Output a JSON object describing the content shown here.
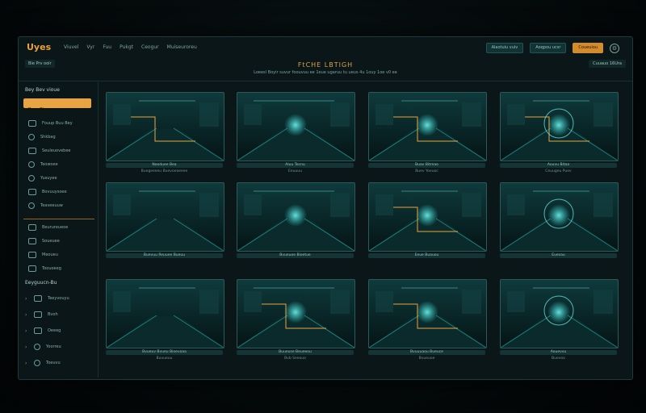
{
  "app": {
    "brand": "Uyes",
    "menu": [
      "Viuvel",
      "Vyr",
      "Fuu",
      "Pukgt",
      "Ceogur",
      "Muiseuroreu"
    ],
    "actions": {
      "btn1": "Alaotuiu vuiv",
      "btn2": "Aoqpou ucsr",
      "btn3": "Coueuiou"
    },
    "gear_icon": "gear-icon"
  },
  "subbar": {
    "left_tag": "Bie Prv ooir",
    "title": "FtCHE LBTIGH",
    "subtitle": "Loeesl Boyir suvur foouvuu ee 1eue ugaruu tu ueus 4u 1ouy 1oe v0 ee",
    "right_tag": "Cuuauo 16Ura"
  },
  "sidebar": {
    "head": "Bey Bev vioue",
    "active": "Dues Bioevo",
    "items": [
      "Fouup Buu Bey",
      "Shkbag",
      "Seuleuovebee",
      "Teowoee",
      "Yusuyee",
      "Bovuuysoee",
      "Teaveeuuw",
      "Beurureueoe",
      "Soueuee",
      "Meoueu",
      "Toouoeeg"
    ],
    "section": "Eeyguucn-Bu",
    "section_items": [
      "Teeyvouyu",
      "Bvoh",
      "Oeeeg",
      "Yoorreu",
      "Toeuvu"
    ]
  },
  "cards": [
    {
      "caption": "Nooduee Bea",
      "sub": "Buegeeeeu Buevoeaeeee"
    },
    {
      "caption": "Aluu Tecnu",
      "sub": "Eeuuuu"
    },
    {
      "caption": "Buav Bitmao",
      "sub": "Buev Yoeuoc"
    },
    {
      "caption": "Aouvu Bitaa",
      "sub": "Ceuugeu Puev"
    },
    {
      "caption": "Buevuu Reuuee Bueuu",
      "sub": ""
    },
    {
      "caption": "Bvueuoe Bioetue",
      "sub": ""
    },
    {
      "caption": "Eeue Buauou",
      "sub": ""
    },
    {
      "caption": "Euesau",
      "sub": ""
    },
    {
      "caption": "Bvueuv Bvueu Bioevoaa",
      "sub": "Buvueuu"
    },
    {
      "caption": "Buueuse Beueeou",
      "sub": "Bvb Seeouo"
    },
    {
      "caption": "Bvuuuaou Bueuce",
      "sub": "Bvueuoe"
    },
    {
      "caption": "Aouevvu",
      "sub": "Buevoo"
    }
  ],
  "colors": {
    "accent": "#e8a443",
    "teal": "#2fd6d0",
    "bg": "#0a1617"
  }
}
